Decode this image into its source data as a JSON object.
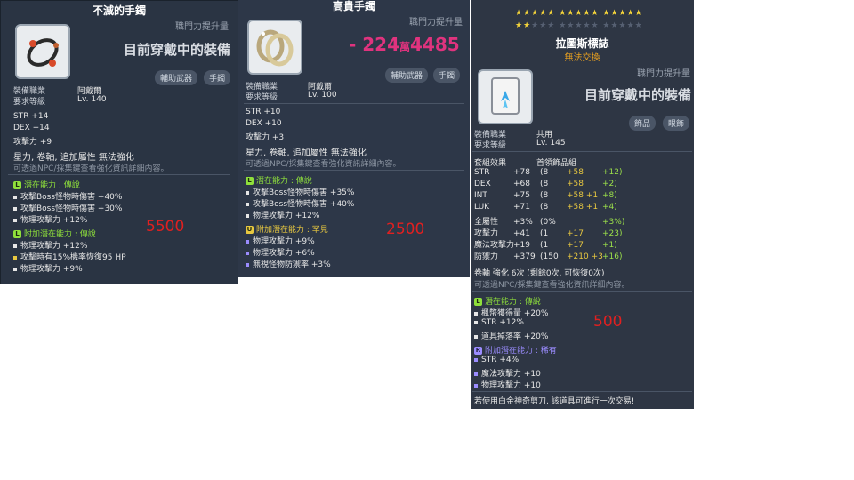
{
  "panel1": {
    "title": "不滅的手鐲",
    "job_increase": "職門力提升量",
    "wearing": "目前穿戴中的裝備",
    "tags": [
      "輔助武器",
      "手鐲"
    ],
    "job_label": "裝備職業",
    "job_value": "阿戴爾",
    "level_label": "要求等級",
    "level_value": "Lv. 140",
    "stats": [
      "STR  +14",
      "DEX  +14",
      "攻擊力  +9"
    ],
    "flags": "星力, 卷軸, 追加屬性 無法強化",
    "hint": "可透過NPC/採集鍵查看強化資訊詳細內容。",
    "potential_title": "潛在能力 : 傳說",
    "potential_lines": [
      "攻擊Boss怪物時傷害 +40%",
      "攻擊Boss怪物時傷害 +30%",
      "物理攻擊力 +12%"
    ],
    "add_potential_title": "附加潛在能力 : 傳說",
    "add_potential_lines": [
      "物理攻擊力 +12%",
      "攻擊時有15%機率恢復95 HP",
      "物理攻擊力 +9%"
    ],
    "price": "5500"
  },
  "panel2": {
    "title": "高貴手鐲",
    "job_increase": "職門力提升量",
    "delta_sign": "- 224",
    "delta_unit": "萬",
    "delta_rest": "4485",
    "tags": [
      "輔助武器",
      "手鐲"
    ],
    "job_label": "裝備職業",
    "job_value": "阿戴爾",
    "level_label": "要求等級",
    "level_value": "Lv. 100",
    "stats": [
      "STR  +10",
      "DEX  +10",
      "攻擊力  +3"
    ],
    "flags": "星力, 卷軸, 追加屬性 無法強化",
    "hint": "可透過NPC/採集鍵查看強化資訊詳細內容。",
    "potential_title": "潛在能力 : 傳說",
    "potential_lines": [
      "攻擊Boss怪物時傷害 +35%",
      "攻擊Boss怪物時傷害 +40%",
      "物理攻擊力 +12%"
    ],
    "add_potential_title": "附加潛在能力 : 罕見",
    "add_potential_lines": [
      "物理攻擊力 +9%",
      "物理攻擊力 +6%",
      "無視怪物防禦率 +3%"
    ],
    "price": "2500"
  },
  "panel3": {
    "title": "拉圖斯標誌",
    "untradable": "無法交換",
    "job_increase": "職門力提升量",
    "wearing": "目前穿戴中的裝備",
    "tags": [
      "飾品",
      "眼飾"
    ],
    "job_label": "裝備職業",
    "job_value": "共用",
    "level_label": "要求等級",
    "level_value": "Lv. 145",
    "set_label": "套組效果",
    "set_name": "首領飾品組",
    "stats": [
      {
        "name": "STR",
        "total": "+78",
        "base": "(8",
        "scroll": "+58",
        "bonus": "+12)"
      },
      {
        "name": "DEX",
        "total": "+68",
        "base": "(8",
        "scroll": "+58",
        "bonus": "+2)"
      },
      {
        "name": "INT",
        "total": "+75",
        "base": "(8",
        "scroll": "+58 +1",
        "bonus": "+8)"
      },
      {
        "name": "LUK",
        "total": "+71",
        "base": "(8",
        "scroll": "+58 +1",
        "bonus": "+4)"
      },
      {
        "name": "全屬性",
        "total": "+3%",
        "base": "(0%",
        "scroll": "",
        "bonus": "+3%)"
      },
      {
        "name": "攻擊力",
        "total": "+41",
        "base": "(1",
        "scroll": "+17",
        "bonus": "+23)"
      },
      {
        "name": "魔法攻擊力",
        "total": "+19",
        "base": "(1",
        "scroll": "+17",
        "bonus": "+1)"
      },
      {
        "name": "防禦力",
        "total": "+379",
        "base": "(150",
        "scroll": "+210 +3",
        "bonus": "+16)"
      }
    ],
    "enhance": "卷軸 強化 6次 (剩餘0次, 可恢復0次)",
    "hint": "可透過NPC/採集鍵查看強化資訊詳細內容。",
    "potential_title": "潛在能力 : 傳說",
    "potential_lines": [
      "楓幣獲得量 +20%",
      "STR +12%",
      "道具掉落率 +20%"
    ],
    "add_potential_title": "附加潛在能力 : 稀有",
    "add_potential_lines": [
      "STR +4%",
      "魔法攻擊力 +10",
      "物理攻擊力 +10"
    ],
    "footer": "若使用白金神奇剪刀, 該道具可進行一次交易!",
    "price": "500"
  },
  "colors": {
    "legendary": "#8fe03b",
    "unique": "#e8c840",
    "rare": "#9b8cff",
    "price": "#e02020"
  },
  "icons": [
    "ring-item-icon",
    "double-ring-item-icon",
    "badge-item-icon"
  ]
}
